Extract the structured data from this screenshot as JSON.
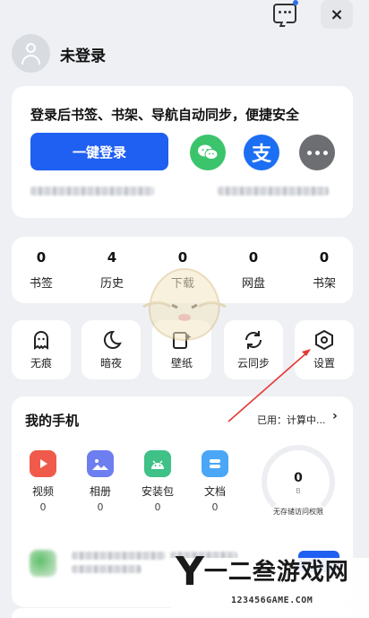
{
  "topbar": {
    "message_icon": "chat-message-icon",
    "close_label": "×"
  },
  "user": {
    "name": "未登录"
  },
  "login": {
    "title": "登录后书签、书架、导航自动同步，便捷安全",
    "button_label": "一键登录",
    "alipay_glyph": "支"
  },
  "stats": [
    {
      "num": "0",
      "label": "书签"
    },
    {
      "num": "4",
      "label": "历史"
    },
    {
      "num": "0",
      "label": "下载"
    },
    {
      "num": "0",
      "label": "网盘"
    },
    {
      "num": "0",
      "label": "书架"
    }
  ],
  "tools": [
    {
      "label": "无痕",
      "icon": "ghost-icon"
    },
    {
      "label": "暗夜",
      "icon": "moon-icon"
    },
    {
      "label": "壁纸",
      "icon": "wallpaper-icon"
    },
    {
      "label": "云同步",
      "icon": "sync-icon"
    },
    {
      "label": "设置",
      "icon": "settings-hex-icon"
    }
  ],
  "phone": {
    "title": "我的手机",
    "used": "已用：计算中...",
    "chevron": "›",
    "apps": [
      {
        "name": "视频",
        "count": "0",
        "color": "#f05a4a"
      },
      {
        "name": "相册",
        "count": "0",
        "color": "#6d7ef0"
      },
      {
        "name": "安装包",
        "count": "0",
        "color": "#3fc187"
      },
      {
        "name": "文档",
        "count": "0",
        "color": "#4aa7f7"
      }
    ],
    "gauge_value": "0",
    "gauge_unit": "B",
    "gauge_note": "无存储访问权限"
  },
  "watermark": {
    "letter": "Y",
    "text": "一二叁游戏网",
    "url": "123456GAME.COM"
  },
  "colors": {
    "accent": "#1f5ff1",
    "wechat": "#3bc46b",
    "alipay": "#1c6ff2",
    "arrow": "#e53935"
  }
}
